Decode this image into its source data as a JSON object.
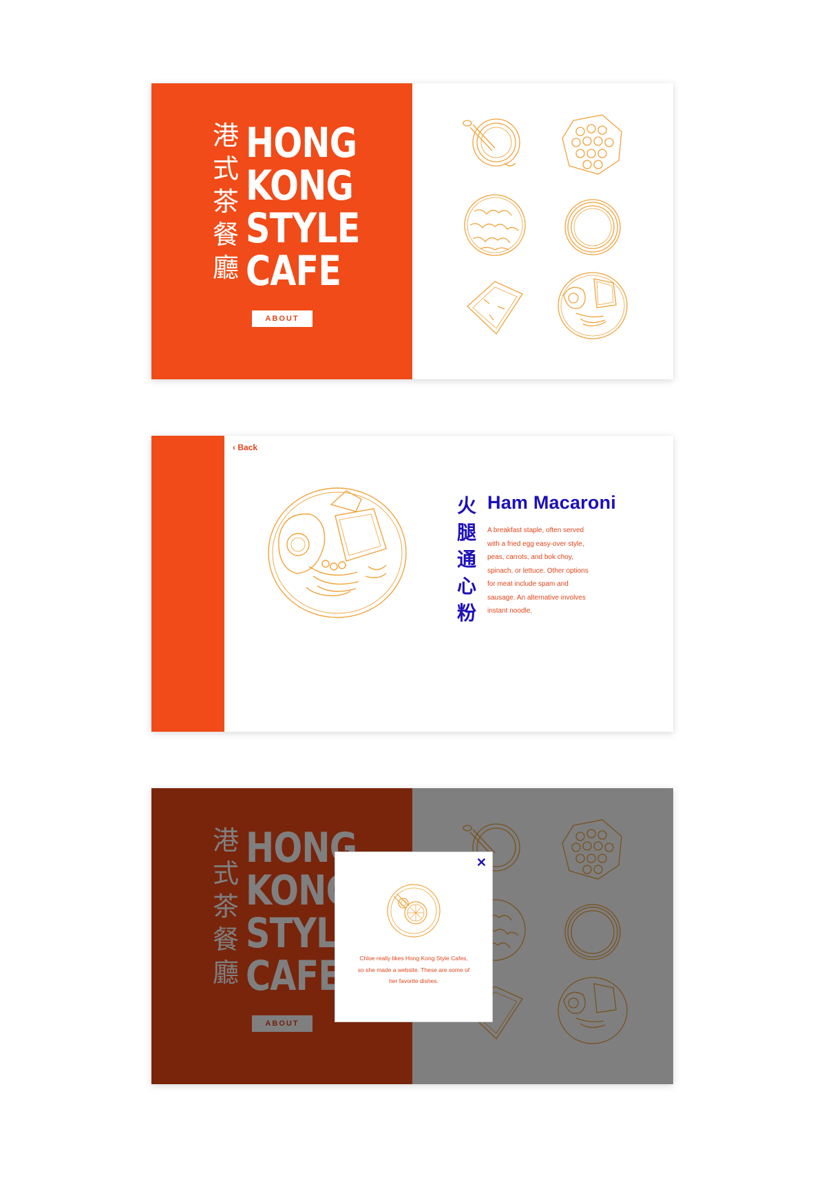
{
  "colors": {
    "brand_orange": "#f04b18",
    "sketch_orange": "#f0a23a",
    "dish_blue": "#1d10b8",
    "text_orange": "#e0441a"
  },
  "home": {
    "title_cn": "港式茶餐廳",
    "title_lines": [
      "HONG",
      "KONG",
      "STYLE",
      "CAFE"
    ],
    "about_label": "ABOUT",
    "dishes": [
      {
        "icon": "milk-tea-icon"
      },
      {
        "icon": "egg-waffle-icon"
      },
      {
        "icon": "pineapple-bun-icon"
      },
      {
        "icon": "egg-tart-icon"
      },
      {
        "icon": "french-toast-icon"
      },
      {
        "icon": "ham-macaroni-icon"
      }
    ]
  },
  "detail": {
    "back_label": "‹ Back",
    "name_cn": "火腿通心粉",
    "name_en": "Ham Macaroni",
    "description": "A breakfast staple, often served with a fried egg easy-over style, peas, carrots, and bok choy, spinach, or lettuce. Other options for meat include spam and sausage. An alternative involves instant noodle.",
    "image_icon": "ham-macaroni-icon"
  },
  "about_modal": {
    "close_label": "✕",
    "image_icon": "lemon-tea-icon",
    "text": "Chloe really likes Hong Kong Style Cafes, so she made a website. These are some of her favorite dishes."
  }
}
